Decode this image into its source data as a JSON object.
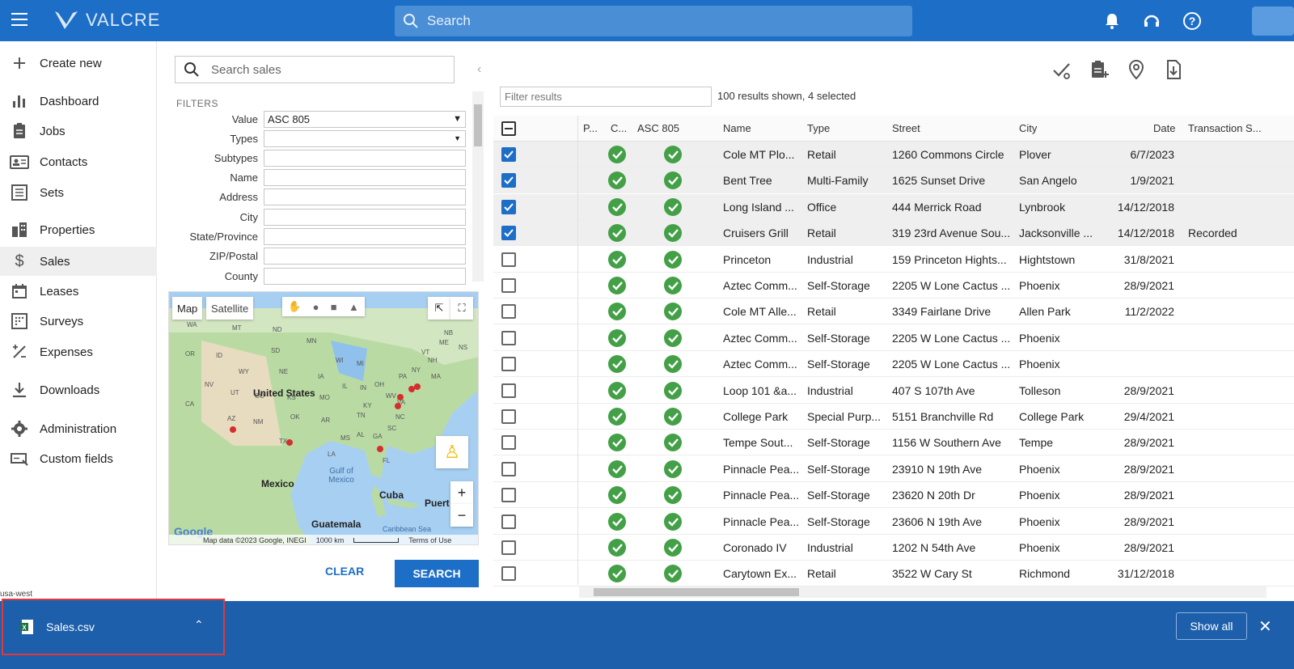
{
  "app": {
    "brand": "VALCRE",
    "search_placeholder": "Search"
  },
  "sidebar": {
    "create_new": "Create new",
    "items": [
      {
        "label": "Dashboard",
        "icon": "bar-chart-icon"
      },
      {
        "label": "Jobs",
        "icon": "clipboard-icon"
      },
      {
        "label": "Contacts",
        "icon": "contact-card-icon"
      },
      {
        "label": "Sets",
        "icon": "list-icon"
      },
      {
        "label": "Properties",
        "icon": "building-icon"
      },
      {
        "label": "Sales",
        "icon": "dollar-icon",
        "active": true
      },
      {
        "label": "Leases",
        "icon": "calendar-icon"
      },
      {
        "label": "Surveys",
        "icon": "grid-icon"
      },
      {
        "label": "Expenses",
        "icon": "percent-icon"
      },
      {
        "label": "Downloads",
        "icon": "download-icon"
      },
      {
        "label": "Administration",
        "icon": "gear-icon"
      },
      {
        "label": "Custom fields",
        "icon": "custom-fields-icon"
      }
    ]
  },
  "filters": {
    "search_placeholder": "Search sales",
    "header": "FILTERS",
    "fields": [
      {
        "label": "Value",
        "value": "ASC 805"
      },
      {
        "label": "Types",
        "value": ""
      },
      {
        "label": "Subtypes",
        "value": ""
      },
      {
        "label": "Name",
        "value": ""
      },
      {
        "label": "Address",
        "value": ""
      },
      {
        "label": "City",
        "value": ""
      },
      {
        "label": "State/Province",
        "value": ""
      },
      {
        "label": "ZIP/Postal",
        "value": ""
      },
      {
        "label": "County",
        "value": ""
      }
    ],
    "clear_label": "CLEAR",
    "search_label": "SEARCH"
  },
  "map": {
    "tab_map": "Map",
    "tab_satellite": "Satellite",
    "labels": {
      "us": "United States",
      "mexico": "Mexico",
      "gulf": "Gulf of Mexico",
      "cuba": "Cuba",
      "guatemala": "Guatemala",
      "caribbean": "Caribbean Sea",
      "puerto": "Puert"
    },
    "states": [
      "WA",
      "MT",
      "ND",
      "MN",
      "OR",
      "ID",
      "SD",
      "WI",
      "MI",
      "WY",
      "NE",
      "IA",
      "IL",
      "IN",
      "OH",
      "PA",
      "NV",
      "UT",
      "CO",
      "KS",
      "MO",
      "KY",
      "WV",
      "VA",
      "CA",
      "AZ",
      "NM",
      "OK",
      "AR",
      "TN",
      "NC",
      "SC",
      "MS",
      "AL",
      "GA",
      "TX",
      "LA",
      "FL",
      "NY",
      "ME",
      "VT",
      "NH",
      "MA",
      "NB",
      "NS"
    ],
    "attribution": "Map data ©2023 Google, INEGI",
    "scale": "1000 km",
    "terms": "Terms of Use",
    "google": "Google"
  },
  "results": {
    "filter_placeholder": "Filter results",
    "count_text": "100 results shown, 4 selected",
    "columns": [
      "P...",
      "C...",
      "ASC 805",
      "Name",
      "Type",
      "Street",
      "City",
      "Date",
      "Transaction S..."
    ],
    "rows": [
      {
        "selected": true,
        "name": "Cole MT Plo...",
        "type": "Retail",
        "street": "1260 Commons Circle",
        "city": "Plover",
        "date": "6/7/2023",
        "status": ""
      },
      {
        "selected": true,
        "name": "Bent Tree",
        "type": "Multi-Family",
        "street": "1625 Sunset Drive",
        "city": "San Angelo",
        "date": "1/9/2021",
        "status": ""
      },
      {
        "selected": true,
        "name": "Long Island ...",
        "type": "Office",
        "street": "444 Merrick Road",
        "city": "Lynbrook",
        "date": "14/12/2018",
        "status": ""
      },
      {
        "selected": true,
        "name": "Cruisers Grill",
        "type": "Retail",
        "street": "319 23rd Avenue Sou...",
        "city": "Jacksonville ...",
        "date": "14/12/2018",
        "status": "Recorded"
      },
      {
        "selected": false,
        "name": "Princeton",
        "type": "Industrial",
        "street": "159 Princeton Hights...",
        "city": "Hightstown",
        "date": "31/8/2021",
        "status": ""
      },
      {
        "selected": false,
        "name": "Aztec Comm...",
        "type": "Self-Storage",
        "street": "2205 W Lone Cactus ...",
        "city": "Phoenix",
        "date": "28/9/2021",
        "status": ""
      },
      {
        "selected": false,
        "name": "Cole MT Alle...",
        "type": "Retail",
        "street": "3349 Fairlane Drive",
        "city": "Allen Park",
        "date": "11/2/2022",
        "status": ""
      },
      {
        "selected": false,
        "name": "Aztec Comm...",
        "type": "Self-Storage",
        "street": "2205 W Lone Cactus ...",
        "city": "Phoenix",
        "date": "",
        "status": ""
      },
      {
        "selected": false,
        "name": "Aztec Comm...",
        "type": "Self-Storage",
        "street": "2205 W Lone Cactus ...",
        "city": "Phoenix",
        "date": "",
        "status": ""
      },
      {
        "selected": false,
        "name": "Loop 101 &a...",
        "type": "Industrial",
        "street": "407 S 107th Ave",
        "city": "Tolleson",
        "date": "28/9/2021",
        "status": ""
      },
      {
        "selected": false,
        "name": "College Park",
        "type": "Special Purp...",
        "street": "5151 Branchville Rd",
        "city": "College Park",
        "date": "29/4/2021",
        "status": ""
      },
      {
        "selected": false,
        "name": "Tempe Sout...",
        "type": "Self-Storage",
        "street": "1156 W Southern Ave",
        "city": "Tempe",
        "date": "28/9/2021",
        "status": ""
      },
      {
        "selected": false,
        "name": "Pinnacle Pea...",
        "type": "Self-Storage",
        "street": "23910 N 19th Ave",
        "city": "Phoenix",
        "date": "28/9/2021",
        "status": ""
      },
      {
        "selected": false,
        "name": "Pinnacle Pea...",
        "type": "Self-Storage",
        "street": "23620 N 20th Dr",
        "city": "Phoenix",
        "date": "28/9/2021",
        "status": ""
      },
      {
        "selected": false,
        "name": "Pinnacle Pea...",
        "type": "Self-Storage",
        "street": "23606 N 19th Ave",
        "city": "Phoenix",
        "date": "28/9/2021",
        "status": ""
      },
      {
        "selected": false,
        "name": "Coronado IV",
        "type": "Industrial",
        "street": "1202 N 54th Ave",
        "city": "Phoenix",
        "date": "28/9/2021",
        "status": ""
      },
      {
        "selected": false,
        "name": "Carytown Ex...",
        "type": "Retail",
        "street": "3522 W Cary St",
        "city": "Richmond",
        "date": "31/12/2018",
        "status": ""
      }
    ]
  },
  "footer": {
    "region": "usa-west"
  },
  "download_bar": {
    "file_name": "Sales.csv",
    "show_all": "Show all"
  },
  "colors": {
    "primary": "#1d6ec7",
    "check_green": "#43a047",
    "download_bar": "#1d5fab",
    "highlight_red": "#e0393e"
  }
}
